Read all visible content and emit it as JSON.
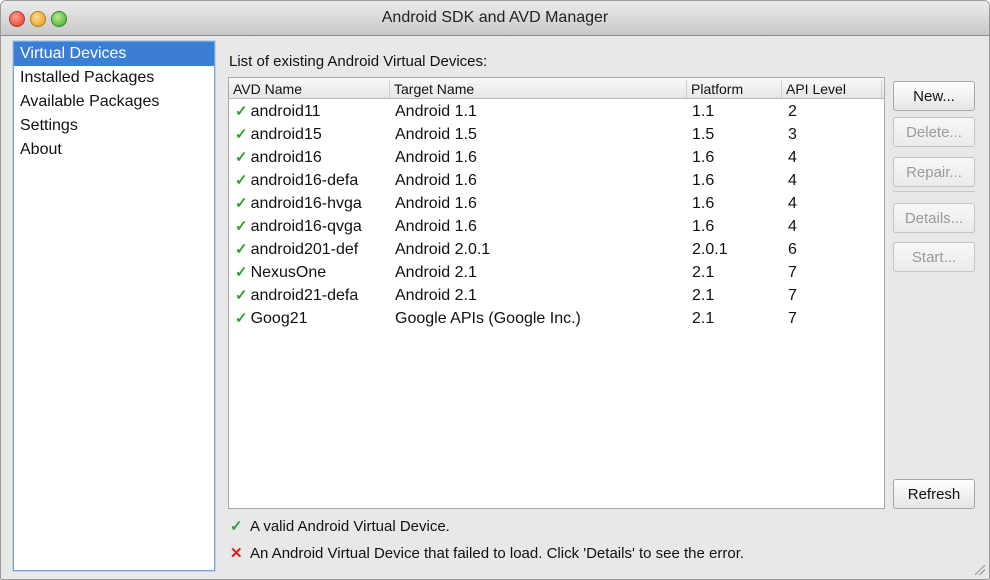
{
  "window": {
    "title": "Android SDK and AVD Manager"
  },
  "sidebar": {
    "items": [
      {
        "label": "Virtual Devices",
        "selected": true
      },
      {
        "label": "Installed Packages",
        "selected": false
      },
      {
        "label": "Available Packages",
        "selected": false
      },
      {
        "label": "Settings",
        "selected": false
      },
      {
        "label": "About",
        "selected": false
      }
    ]
  },
  "main": {
    "caption": "List of existing Android Virtual Devices:",
    "columns": [
      "AVD Name",
      "Target Name",
      "Platform",
      "API Level"
    ],
    "rows": [
      {
        "avd": "android11",
        "target": "Android 1.1",
        "platform": "1.1",
        "api": "2"
      },
      {
        "avd": "android15",
        "target": "Android 1.5",
        "platform": "1.5",
        "api": "3"
      },
      {
        "avd": "android16",
        "target": "Android 1.6",
        "platform": "1.6",
        "api": "4"
      },
      {
        "avd": "android16-defa",
        "target": "Android 1.6",
        "platform": "1.6",
        "api": "4"
      },
      {
        "avd": "android16-hvga",
        "target": "Android 1.6",
        "platform": "1.6",
        "api": "4"
      },
      {
        "avd": "android16-qvga",
        "target": "Android 1.6",
        "platform": "1.6",
        "api": "4"
      },
      {
        "avd": "android201-def",
        "target": "Android 2.0.1",
        "platform": "2.0.1",
        "api": "6"
      },
      {
        "avd": "NexusOne",
        "target": "Android 2.1",
        "platform": "2.1",
        "api": "7"
      },
      {
        "avd": "android21-defa",
        "target": "Android 2.1",
        "platform": "2.1",
        "api": "7"
      },
      {
        "avd": "Goog21",
        "target": "Google APIs (Google Inc.)",
        "platform": "2.1",
        "api": "7"
      }
    ],
    "valid_icon": "checkmark-icon",
    "buttons": {
      "new": "New...",
      "delete": "Delete...",
      "repair": "Repair...",
      "details": "Details...",
      "start": "Start...",
      "refresh": "Refresh"
    },
    "legend": {
      "valid": "A valid Android Virtual Device.",
      "invalid": "An Android Virtual Device that failed to load. Click 'Details' to see the error."
    }
  },
  "colors": {
    "selection": "#3b7ed6",
    "valid": "#2ea12e",
    "invalid": "#d42222"
  }
}
